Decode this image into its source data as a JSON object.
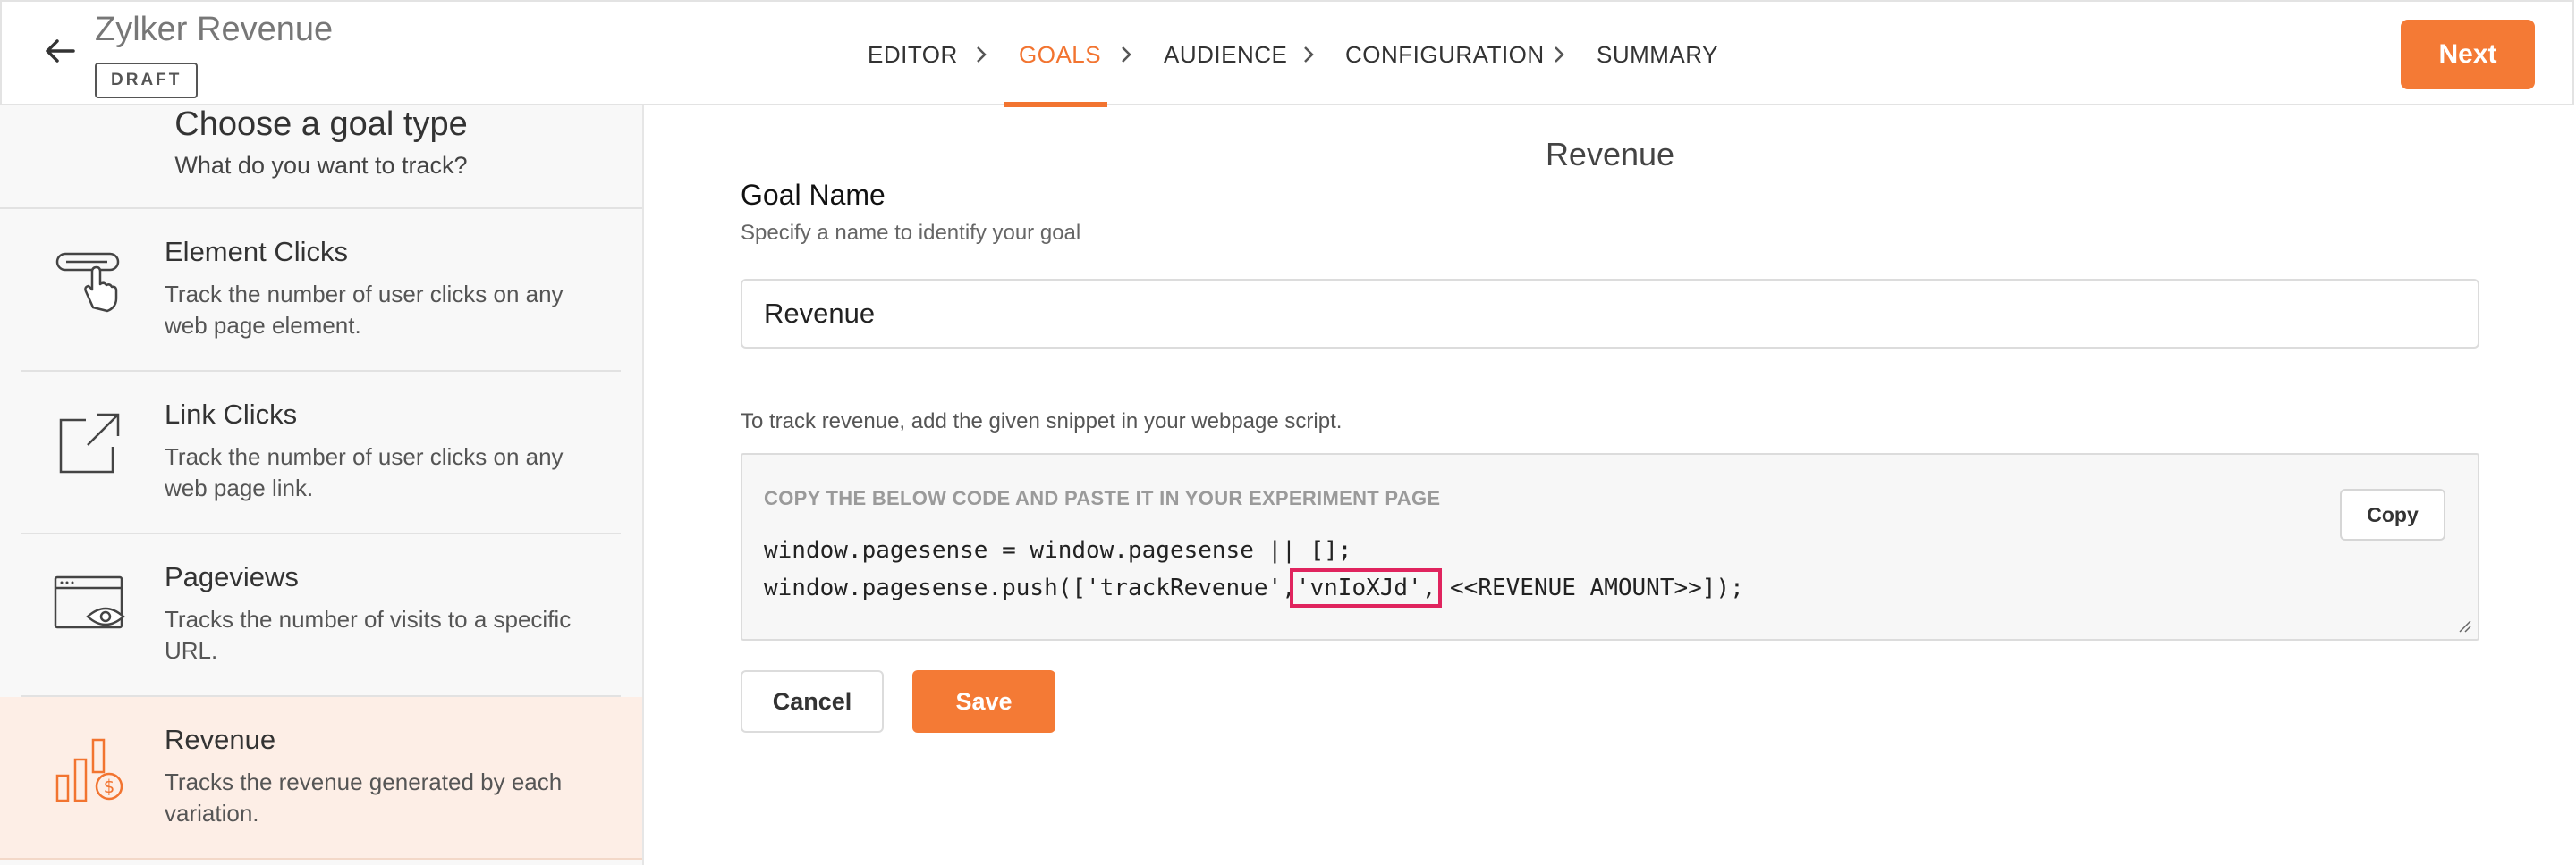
{
  "header": {
    "title": "Zylker Revenue",
    "status_badge": "DRAFT",
    "back_icon": "arrow-left-icon",
    "steps": [
      {
        "label": "EDITOR",
        "active": false
      },
      {
        "label": "GOALS",
        "active": true
      },
      {
        "label": "AUDIENCE",
        "active": false
      },
      {
        "label": "CONFIGURATION",
        "active": false
      },
      {
        "label": "SUMMARY",
        "active": false
      }
    ],
    "next_label": "Next"
  },
  "sidebar": {
    "title": "Choose a goal type",
    "subtitle": "What do you want to track?",
    "items": [
      {
        "name": "Element Clicks",
        "description": "Track the number of user clicks on any web page element.",
        "icon": "element-click-icon",
        "selected": false
      },
      {
        "name": "Link Clicks",
        "description": "Track the number of user clicks on any web page link.",
        "icon": "external-link-icon",
        "selected": false
      },
      {
        "name": "Pageviews",
        "description": "Tracks the number of visits to a specific URL.",
        "icon": "browser-eye-icon",
        "selected": false
      },
      {
        "name": "Revenue",
        "description": "Tracks the revenue generated by each variation.",
        "icon": "revenue-chart-icon",
        "selected": true
      }
    ]
  },
  "main": {
    "title": "Revenue",
    "goal_name_label": "Goal Name",
    "goal_name_help": "Specify a name to identify your goal",
    "goal_name_value": "Revenue",
    "snippet_help": "To track revenue, add the given snippet in your webpage script.",
    "code_caption": "COPY THE BELOW CODE AND PASTE IT IN YOUR EXPERIMENT PAGE",
    "code_line1": "window.pagesense = window.pagesense || [];",
    "code_line2_prefix": "window.pagesense.push(['trackRevenue',",
    "code_line2_key": "'vnIoXJd',",
    "code_line2_suffix": " <<REVENUE AMOUNT>>]);",
    "copy_label": "Copy",
    "cancel_label": "Cancel",
    "save_label": "Save"
  },
  "colors": {
    "accent": "#f47a35",
    "active_step": "#f27430",
    "selected_item_bg": "#fdeee6",
    "highlight_outline": "#e0245e"
  }
}
